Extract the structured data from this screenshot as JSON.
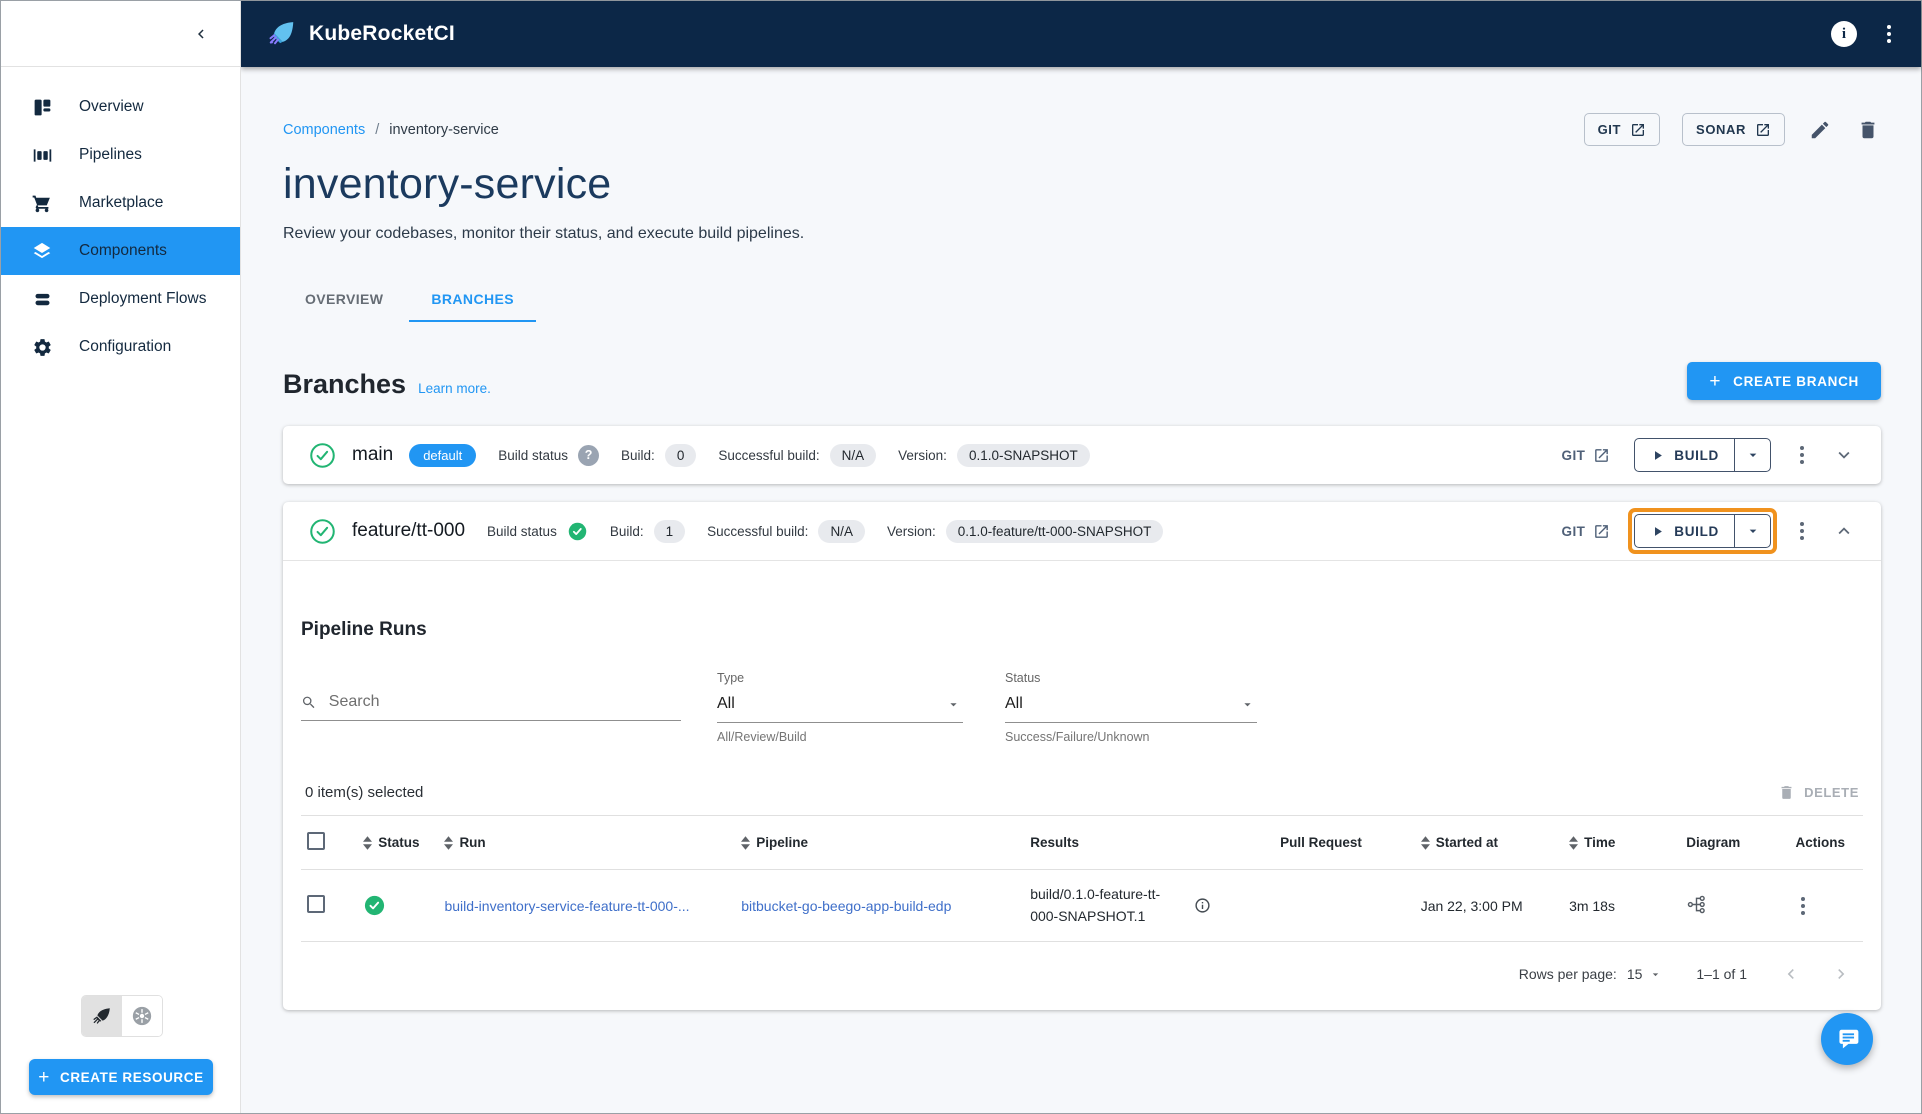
{
  "colors": {
    "accent": "#2196f3",
    "topbar_bg": "#0c2747",
    "success_green": "#22b573",
    "highlight_orange": "#f0921e",
    "link_blue": "#3f6fc9"
  },
  "topbar": {
    "app_name": "KubeRocketCI"
  },
  "sidebar": {
    "items": [
      {
        "label": "Overview",
        "icon": "dashboard-icon",
        "active": false
      },
      {
        "label": "Pipelines",
        "icon": "pipelines-icon",
        "active": false
      },
      {
        "label": "Marketplace",
        "icon": "cart-icon",
        "active": false
      },
      {
        "label": "Components",
        "icon": "layers-icon",
        "active": true
      },
      {
        "label": "Deployment Flows",
        "icon": "stacks-icon",
        "active": false
      },
      {
        "label": "Configuration",
        "icon": "gear-icon",
        "active": false
      }
    ],
    "create_resource_label": "CREATE RESOURCE"
  },
  "header": {
    "breadcrumb": {
      "section": "Components",
      "separator": "/",
      "current": "inventory-service"
    },
    "title": "inventory-service",
    "subtitle": "Review your codebases, monitor their status, and execute build pipelines.",
    "actions": {
      "git": "GIT",
      "sonar": "SONAR"
    }
  },
  "tabs": [
    {
      "label": "OVERVIEW",
      "active": false
    },
    {
      "label": "BRANCHES",
      "active": true
    }
  ],
  "branches": {
    "heading": "Branches",
    "learn_more": "Learn more.",
    "create_branch_label": "CREATE BRANCH",
    "labels": {
      "build_status": "Build status",
      "build": "Build:",
      "successful_build": "Successful build:",
      "version": "Version:",
      "git": "GIT",
      "build_button": "BUILD"
    },
    "rows": [
      {
        "name": "main",
        "default_badge": "default",
        "build_count": "0",
        "successful_build": "N/A",
        "version": "0.1.0-SNAPSHOT",
        "expanded": false
      },
      {
        "name": "feature/tt-000",
        "build_count": "1",
        "successful_build": "N/A",
        "version": "0.1.0-feature/tt-000-SNAPSHOT",
        "expanded": true,
        "build_button_highlighted": true
      }
    ]
  },
  "pipeline_runs": {
    "heading": "Pipeline Runs",
    "search_placeholder": "Search",
    "filters": {
      "type": {
        "label": "Type",
        "value": "All",
        "helper": "All/Review/Build"
      },
      "status": {
        "label": "Status",
        "value": "All",
        "helper": "Success/Failure/Unknown"
      }
    },
    "selection_text": "0 item(s) selected",
    "delete_label": "DELETE",
    "table": {
      "columns": [
        {
          "label": "Status",
          "sortable": true
        },
        {
          "label": "Run",
          "sortable": true
        },
        {
          "label": "Pipeline",
          "sortable": true
        },
        {
          "label": "Results",
          "sortable": false
        },
        {
          "label": "Pull Request",
          "sortable": false
        },
        {
          "label": "Started at",
          "sortable": true
        },
        {
          "label": "Time",
          "sortable": true
        },
        {
          "label": "Diagram",
          "sortable": false
        },
        {
          "label": "Actions",
          "sortable": false
        }
      ],
      "rows": [
        {
          "status": "success",
          "run": "build-inventory-service-feature-tt-000-...",
          "pipeline": "bitbucket-go-beego-app-build-edp",
          "results": "build/0.1.0-feature-tt-000-SNAPSHOT.1",
          "pull_request": "",
          "started_at": "Jan 22, 3:00 PM",
          "time": "3m 18s"
        }
      ]
    },
    "pagination": {
      "rows_per_page_label": "Rows per page:",
      "rows_per_page_value": "15",
      "range": "1–1 of 1"
    }
  }
}
